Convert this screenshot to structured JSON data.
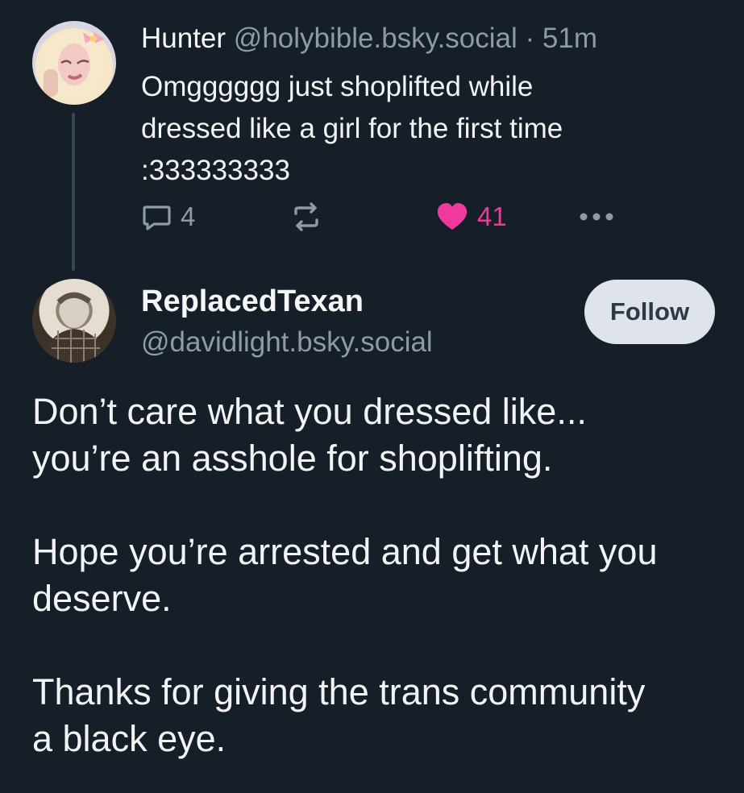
{
  "parent_post": {
    "author_name": "Hunter",
    "handle": "@holybible.bsky.social",
    "separator": "·",
    "time": "51m",
    "text": "Omgggggg just shoplifted while\ndressed like a girl for the first time\n:333333333",
    "actions": {
      "reply_count": "4",
      "like_count": "41",
      "reply_icon": "reply-bubble-icon",
      "repost_icon": "repost-icon",
      "like_icon": "heart-icon",
      "more_icon": "more-ellipsis-icon"
    }
  },
  "reply_post": {
    "author_name": "ReplacedTexan",
    "handle": "@davidlight.bsky.social",
    "follow_label": "Follow",
    "text": "Don’t care what you dressed like...\nyou’re an asshole for shoplifting.\n\nHope you’re arrested and get what you\ndeserve.\n\nThanks for giving the trans community\na black eye."
  },
  "colors": {
    "background": "#161e27",
    "text": "#f1f3f5",
    "muted": "#8d9aa8",
    "like": "#f0389d",
    "follow_bg": "#dfe4ea"
  }
}
